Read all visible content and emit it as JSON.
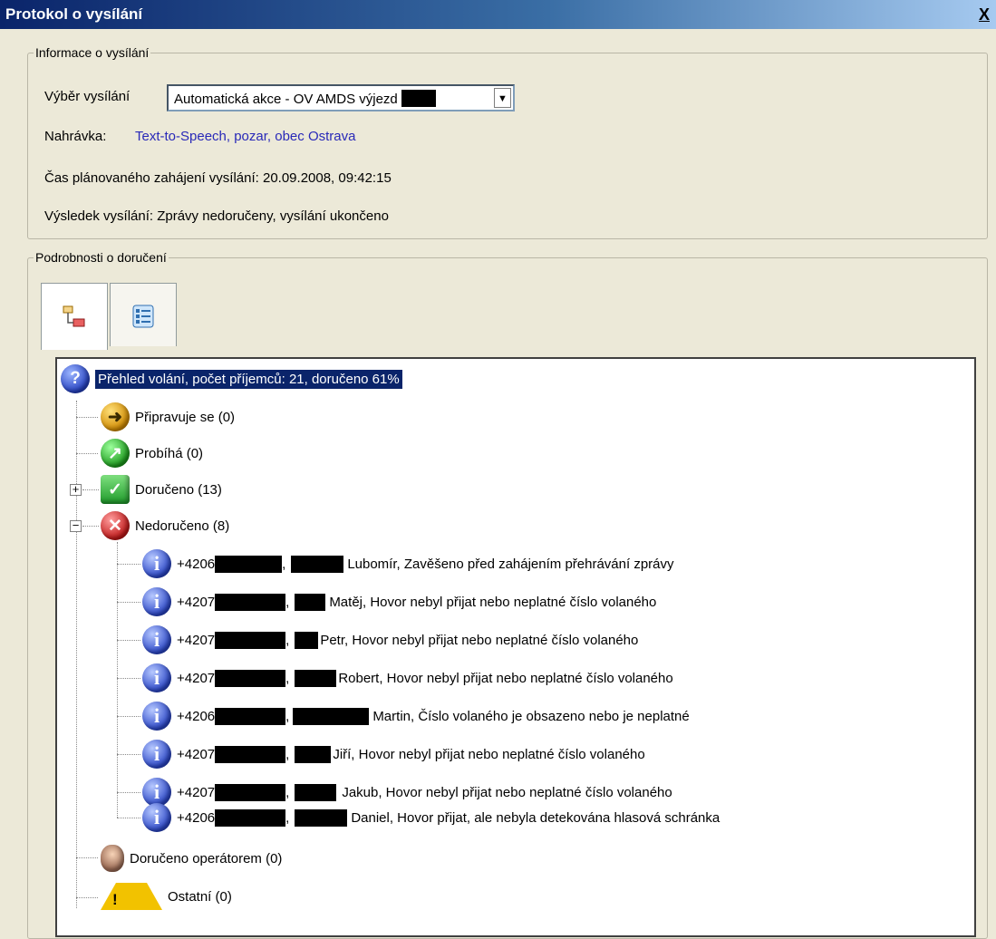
{
  "window": {
    "title": "Protokol o vysílání",
    "close_label": "X"
  },
  "info": {
    "legend": "Informace o vysílání",
    "select_label": "Výběr vysílání",
    "select_value": "Automatická akce - OV AMDS výjezd",
    "recording_label": "Nahrávka:",
    "recording_value": "Text-to-Speech, pozar, obec Ostrava",
    "planned_start": "Čas plánovaného zahájení vysílání: 20.09.2008, 09:42:15",
    "result": "Výsledek vysílání: Zprávy nedoručeny, vysílání ukončeno"
  },
  "details": {
    "legend": "Podrobnosti o doručení",
    "tabs": [
      {
        "icon": "tree-view-icon"
      },
      {
        "icon": "list-view-icon"
      }
    ],
    "tree": {
      "root": "Přehled volání, počet příjemců: 21, doručeno 61%",
      "categories": {
        "preparing": "Připravuje se (0)",
        "running": "Probíhá (0)",
        "delivered": "Doručeno (13)",
        "undelivered": "Nedoručeno (8)",
        "operator": "Doručeno operátorem (0)",
        "other": "Ostatní (0)"
      },
      "undelivered_items": [
        {
          "prefix": "+4206",
          "name": "Lubomír, Zavěšeno před zahájením přehrávání zprávy"
        },
        {
          "prefix": "+4207",
          "name": "Matěj, Hovor nebyl přijat nebo neplatné číslo volaného"
        },
        {
          "prefix": "+4207",
          "name": "Petr, Hovor nebyl přijat nebo neplatné číslo volaného"
        },
        {
          "prefix": "+4207",
          "name": "Robert, Hovor nebyl přijat nebo neplatné číslo volaného"
        },
        {
          "prefix": "+4206",
          "name": "Martin, Číslo volaného je obsazeno nebo je neplatné"
        },
        {
          "prefix": "+4207",
          "name": "Jiří, Hovor nebyl přijat nebo neplatné číslo volaného"
        },
        {
          "prefix": "+4207",
          "name": "Jakub, Hovor nebyl přijat nebo neplatné číslo volaného"
        },
        {
          "prefix": "+4206",
          "name": "Daniel, Hovor přijat, ale nebyla detekována hlasová schránka"
        }
      ]
    }
  }
}
